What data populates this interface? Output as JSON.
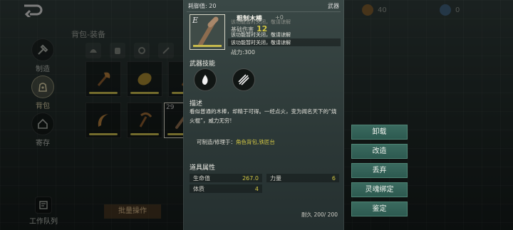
{
  "nav": {
    "craft": "制造",
    "bag": "背包",
    "storage": "寄存",
    "team": "工作队列"
  },
  "bag": {
    "title": "背包-装备",
    "slot_badge": "29",
    "batch_label": "批量操作"
  },
  "resources": {
    "coin_value": "40",
    "gem_value": "0"
  },
  "detail": {
    "durability_stat": "耗御值: 20",
    "category": "武器",
    "tier": "E",
    "item_name": "粗制木棒",
    "plus": "+0",
    "base_label": "基础伤害",
    "base_value": "12",
    "locked_1": "该功能暂时关闭，敬请谅解",
    "locked_2": "该功能暂时关闭，敬请谅解",
    "locked_3": "该功能暂时关闭，敬请谅解",
    "power": "战力:300",
    "skills_title": "武器技能",
    "desc_title": "描述",
    "desc_text": "看似普通的木棒，却精于可得。一经点火，变为闻名天下的“烧火棍”，威力无穷!",
    "repair_prefix": "可制造/修理于：",
    "repair_places": "角色背包,铁匠台",
    "attrs_title": "道具属性",
    "attrs": [
      {
        "label": "生命值",
        "value": "267.0"
      },
      {
        "label": "力量",
        "value": "6"
      },
      {
        "label": "体质",
        "value": "4"
      }
    ],
    "durability": "耐久 200/ 200"
  },
  "actions": {
    "unequip": "卸载",
    "reforge": "改造",
    "discard": "丢弃",
    "soulbind": "灵魂绑定",
    "appraise": "鉴定"
  },
  "colors": {
    "accent_yellow": "#d3c743",
    "button_green": "#2d5a50",
    "panel_bg": "#2c3837"
  }
}
